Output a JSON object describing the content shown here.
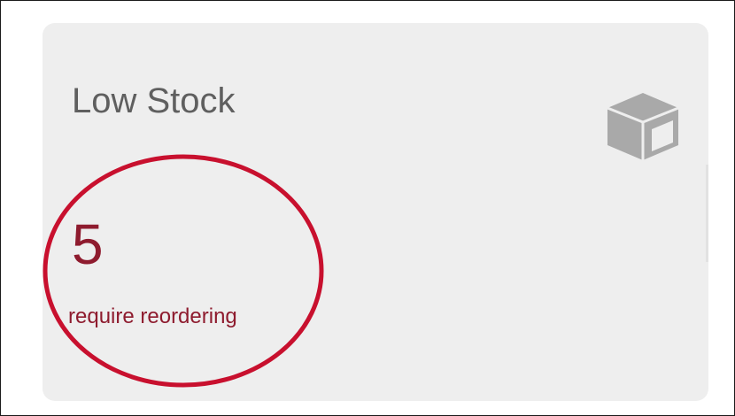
{
  "card": {
    "title": "Low Stock",
    "icon": "box-icon",
    "value": "5",
    "caption": "require reordering"
  },
  "annotation": {
    "shape": "ellipse",
    "color": "#c8102e"
  },
  "colors": {
    "card_background": "#eeeeee",
    "title_text": "#5f5f5f",
    "metric_text": "#8e1b2e",
    "icon": "#a9a9a9"
  }
}
